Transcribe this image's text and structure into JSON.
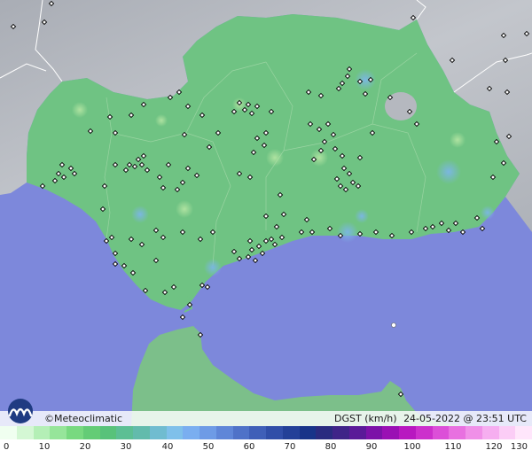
{
  "brand": {
    "symbol": "©",
    "name": "Meteoclimatic"
  },
  "caption": {
    "variable": "DGST (km/h)",
    "datetime": "24-05-2022 @ 23:51 UTC"
  },
  "scale": {
    "ticks": [
      "0",
      "10",
      "20",
      "30",
      "40",
      "50",
      "60",
      "70",
      "80",
      "90",
      "100",
      "110",
      "120",
      "130"
    ],
    "colors": [
      "#f0fff0",
      "#d4f7d4",
      "#b4efb6",
      "#96e59a",
      "#78d980",
      "#64cc76",
      "#58c27a",
      "#5cbf94",
      "#62bbac",
      "#70bcd0",
      "#7fc0ea",
      "#7aaef0",
      "#6e9be6",
      "#5f86d8",
      "#4f72c8",
      "#3f5fb8",
      "#304ea8",
      "#234098",
      "#183489",
      "#2a2b80",
      "#3f2488",
      "#5a1a98",
      "#7c12a8",
      "#9a10b4",
      "#b818c0",
      "#cc30cc",
      "#dc4fd8",
      "#e870e0",
      "#f090e8",
      "#f6aef0",
      "#fbcdf6",
      "#ffe6fb"
    ]
  },
  "map": {
    "sea_color": "#7d88db",
    "land_color": "#6fc383",
    "outside_color": "#b9bcc2"
  }
}
